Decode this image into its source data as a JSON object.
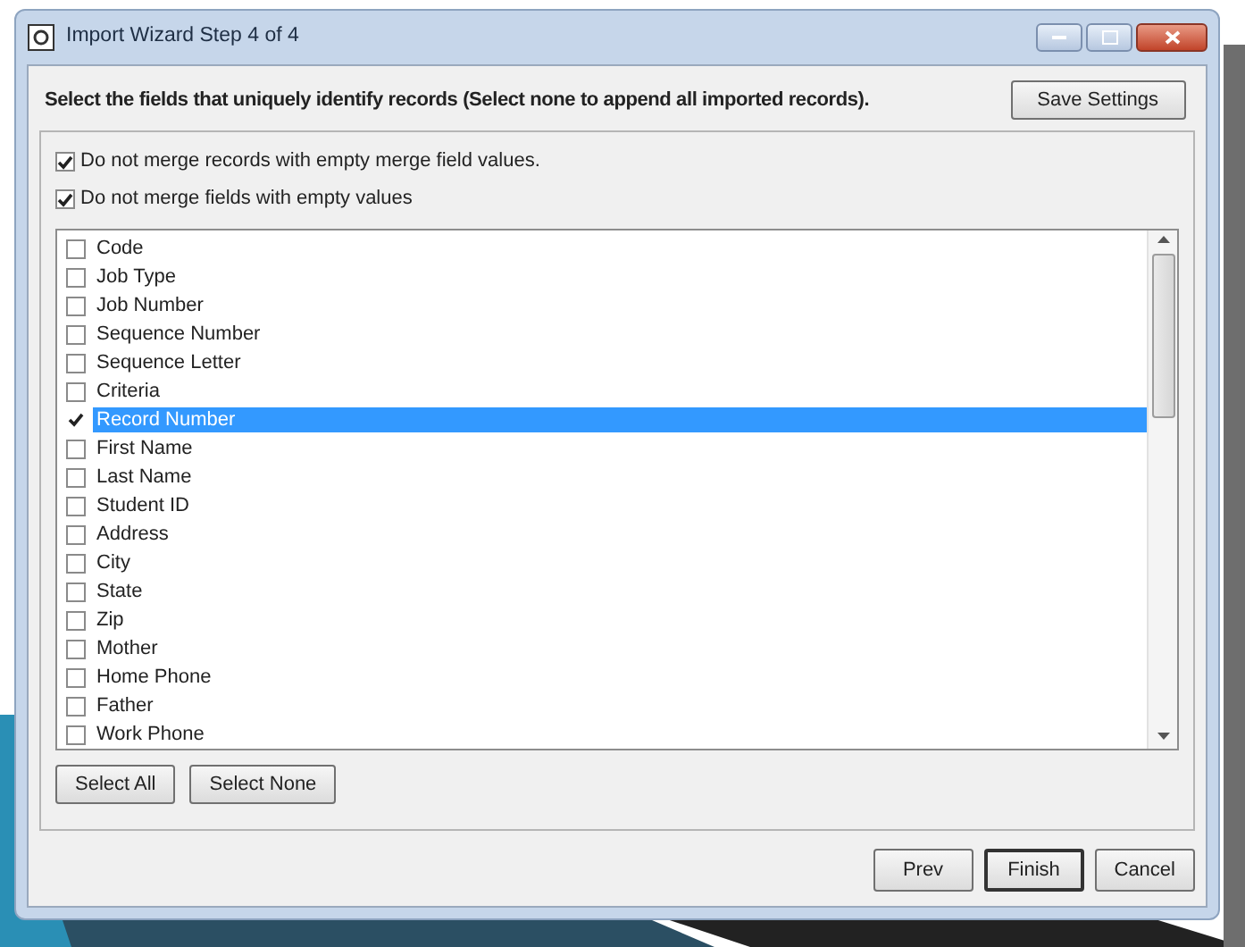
{
  "window": {
    "title": "Import Wizard Step 4 of 4"
  },
  "instruction": "Select the fields that uniquely identify records (Select none to append all imported records).",
  "save_button": "Save Settings",
  "options": [
    {
      "label": "Do not merge records with empty merge field values.",
      "checked": true
    },
    {
      "label": "Do not merge fields with empty values",
      "checked": true
    }
  ],
  "fields": [
    {
      "label": "Code",
      "checked": false,
      "selected": false
    },
    {
      "label": "Job Type",
      "checked": false,
      "selected": false
    },
    {
      "label": "Job Number",
      "checked": false,
      "selected": false
    },
    {
      "label": "Sequence Number",
      "checked": false,
      "selected": false
    },
    {
      "label": "Sequence Letter",
      "checked": false,
      "selected": false
    },
    {
      "label": "Criteria",
      "checked": false,
      "selected": false
    },
    {
      "label": "Record Number",
      "checked": true,
      "selected": true
    },
    {
      "label": "First Name",
      "checked": false,
      "selected": false
    },
    {
      "label": "Last Name",
      "checked": false,
      "selected": false
    },
    {
      "label": "Student ID",
      "checked": false,
      "selected": false
    },
    {
      "label": "Address",
      "checked": false,
      "selected": false
    },
    {
      "label": "City",
      "checked": false,
      "selected": false
    },
    {
      "label": "State",
      "checked": false,
      "selected": false
    },
    {
      "label": "Zip",
      "checked": false,
      "selected": false
    },
    {
      "label": "Mother",
      "checked": false,
      "selected": false
    },
    {
      "label": "Home Phone",
      "checked": false,
      "selected": false
    },
    {
      "label": "Father",
      "checked": false,
      "selected": false
    },
    {
      "label": "Work Phone",
      "checked": false,
      "selected": false
    }
  ],
  "list_buttons": [
    "Select All",
    "Select None"
  ],
  "footer_buttons": [
    {
      "label": "Prev",
      "default": false
    },
    {
      "label": "Finish",
      "default": true
    },
    {
      "label": "Cancel",
      "default": false
    }
  ]
}
